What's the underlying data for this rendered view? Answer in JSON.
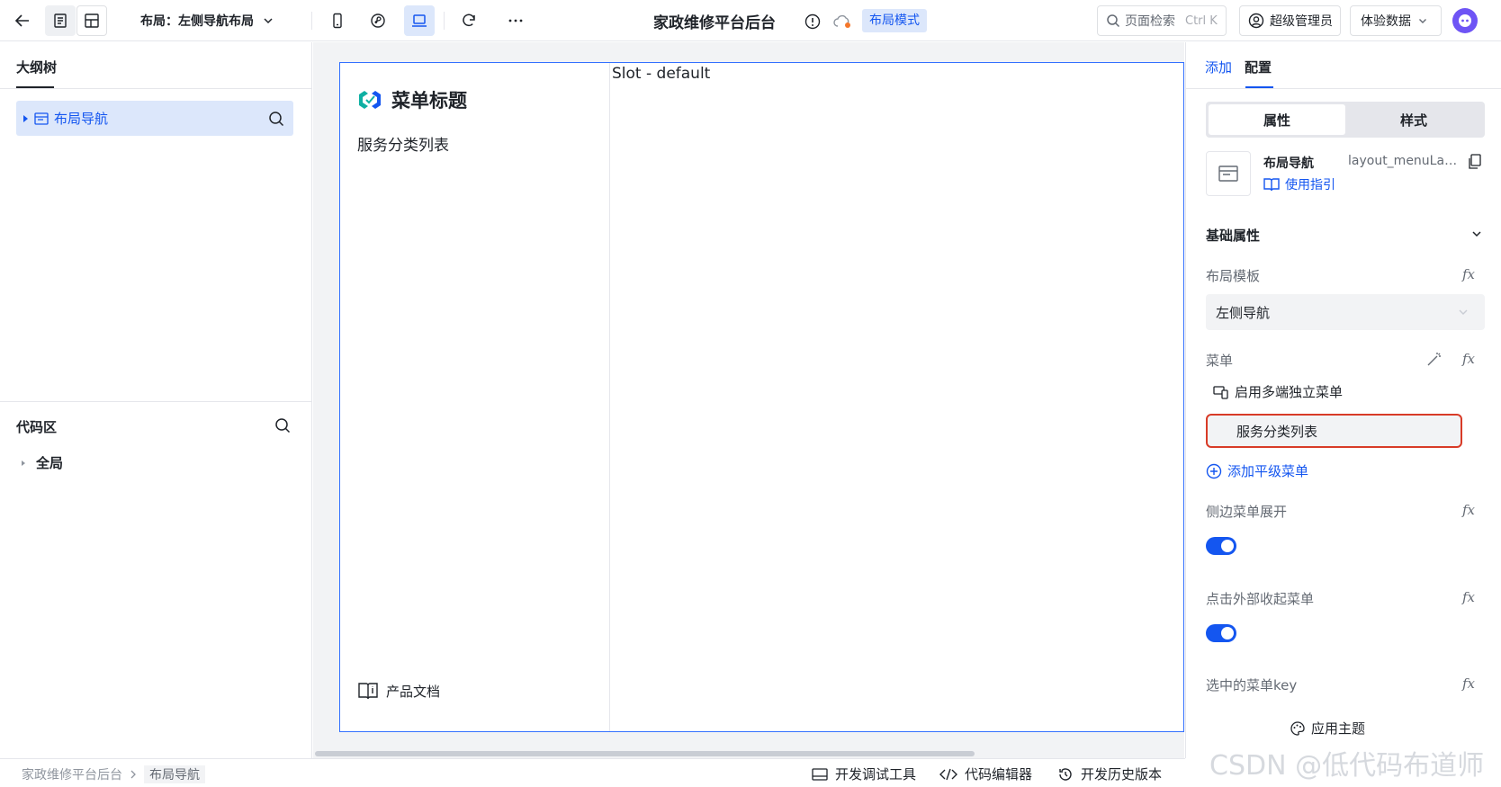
{
  "topbar": {
    "layout_label": "布局：左侧导航布局",
    "app_title": "家政维修平台后台",
    "mode_badge": "布局模式",
    "search_label": "页面检索",
    "search_shortcut": "Ctrl K",
    "admin_label": "超级管理员",
    "data_label": "体验数据",
    "icons": [
      "back-arrow-icon",
      "page-list-icon",
      "layout-icon",
      "mobile-icon",
      "mini-program-icon",
      "laptop-icon",
      "refresh-icon",
      "more-icon",
      "info-icon",
      "cloud-sync-icon",
      "search-icon",
      "user-icon",
      "chevron-down-icon",
      "assistant-icon"
    ]
  },
  "outline": {
    "title": "大纲树",
    "tree_item": "布局导航",
    "code_title": "代码区",
    "global_item": "全局"
  },
  "canvas": {
    "menu_title": "菜单标题",
    "menu_item": "服务分类列表",
    "doc_link": "产品文档",
    "slot_label": "Slot - default"
  },
  "config": {
    "tabs": [
      "添加",
      "配置"
    ],
    "active_tab": "配置",
    "segments": [
      "属性",
      "样式"
    ],
    "active_segment": "属性",
    "component_name": "布局导航",
    "component_id": "layout_menuLayout1",
    "guide_label": "使用指引",
    "basic_section": "基础属性",
    "layout_template_label": "布局模板",
    "layout_template_value": "左侧导航",
    "menu_label": "菜单",
    "multi_menu_label": "启用多端独立菜单",
    "menu_entry": "服务分类列表",
    "add_menu_label": "添加平级菜单",
    "side_expand_label": "侧边菜单展开",
    "side_expand_on": true,
    "click_collapse_label": "点击外部收起菜单",
    "click_collapse_on": true,
    "selected_key_label": "选中的菜单key",
    "fx_label": "fx",
    "theme_label": "应用主题"
  },
  "bottom": {
    "breadcrumb": [
      "家政维修平台后台",
      "布局导航"
    ],
    "debug_tool": "开发调试工具",
    "code_editor": "代码编辑器",
    "history": "开发历史版本"
  },
  "watermark": "CSDN @低代码布道师",
  "colors": {
    "accent": "#1456f0",
    "highlight_border": "#d83b27",
    "selected_bg": "#dce7fb",
    "canvas_bg": "#f2f3f5"
  }
}
